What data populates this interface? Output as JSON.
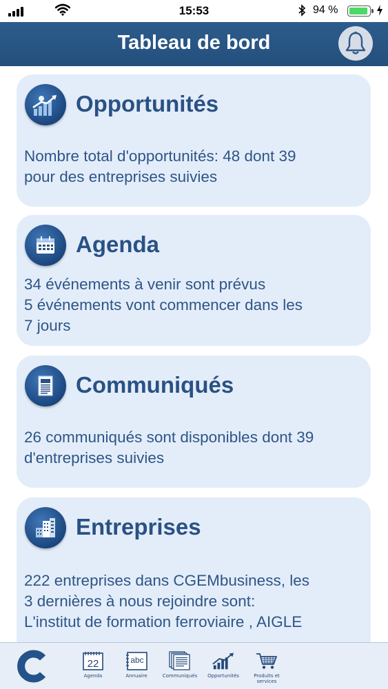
{
  "status_bar": {
    "time": "15:53",
    "battery_percent": "94 %",
    "battery_level": 0.94
  },
  "header": {
    "title": "Tableau de bord",
    "bell_icon": "bell-icon"
  },
  "cards": [
    {
      "title": "Opportunités",
      "icon": "growth-chart-icon",
      "lines": [
        "Nombre total d'opportunités: 48 dont 39",
        "pour des entreprises suivies"
      ]
    },
    {
      "title": "Agenda",
      "icon": "calendar-icon",
      "lines": [
        "34 événements à venir sont prévus",
        "5 événements vont commencer dans les",
        "7 jours"
      ]
    },
    {
      "title": "Communiqués",
      "icon": "document-icon",
      "lines": [
        "26 communiqués sont disponibles dont 39",
        "d'entreprises suivies"
      ]
    },
    {
      "title": "Entreprises",
      "icon": "buildings-icon",
      "lines": [
        "222 entreprises dans CGEMbusiness, les",
        "3 dernières à nous rejoindre sont:",
        "L'institut de formation ferroviaire , AIGLE"
      ]
    }
  ],
  "tabbar": {
    "home_icon": "home-logo-icon",
    "tabs": [
      {
        "label": "Agenda",
        "icon": "calendar-icon",
        "icon_text": "22"
      },
      {
        "label": "Annuaire",
        "icon": "directory-icon",
        "icon_text": "abc"
      },
      {
        "label": "Communiqués",
        "icon": "documents-icon"
      },
      {
        "label": "Opportunités",
        "icon": "chart-icon"
      },
      {
        "label": "Produits et services",
        "icon": "cart-icon"
      }
    ]
  },
  "colors": {
    "header_bg": "#2c5c8c",
    "card_bg": "#e3edf9",
    "text": "#2e5587",
    "battery_green": "#4cd964"
  }
}
